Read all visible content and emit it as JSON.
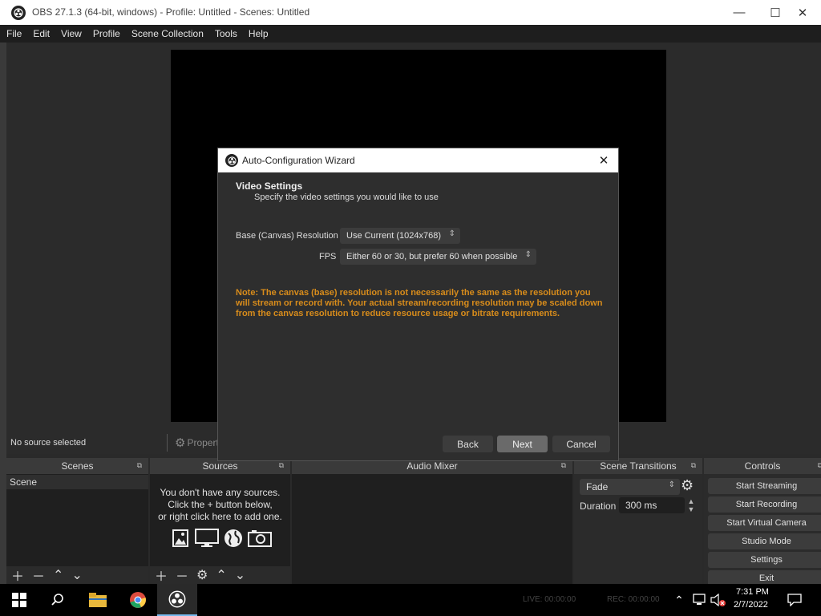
{
  "window": {
    "title": "OBS 27.1.3 (64-bit, windows) - Profile: Untitled - Scenes: Untitled",
    "minimize": "—",
    "maximize": "☐",
    "close": "✕"
  },
  "menu": {
    "items": [
      "File",
      "Edit",
      "View",
      "Profile",
      "Scene Collection",
      "Tools",
      "Help"
    ]
  },
  "status": {
    "no_source": "No source selected",
    "properties": "Properties"
  },
  "panels": {
    "scenes": {
      "title": "Scenes",
      "items": [
        "Scene"
      ]
    },
    "sources": {
      "title": "Sources",
      "empty_line1": "You don't have any sources.",
      "empty_line2": "Click the + button below,",
      "empty_line3": "or right click here to add one."
    },
    "audio_mixer": {
      "title": "Audio Mixer"
    },
    "scene_transitions": {
      "title": "Scene Transitions",
      "transition": "Fade",
      "duration_label": "Duration",
      "duration_value": "300 ms"
    },
    "controls": {
      "title": "Controls",
      "buttons": [
        "Start Streaming",
        "Start Recording",
        "Start Virtual Camera",
        "Studio Mode",
        "Settings",
        "Exit"
      ]
    }
  },
  "dialog": {
    "title": "Auto-Configuration Wizard",
    "heading": "Video Settings",
    "subheading": "Specify the video settings you would like to use",
    "resolution_label": "Base (Canvas) Resolution",
    "resolution_value": "Use Current (1024x768)",
    "fps_label": "FPS",
    "fps_value": "Either 60 or 30, but prefer 60 when possible",
    "note": "Note: The canvas (base) resolution is not necessarily the same as the resolution you will stream or record with. Your actual stream/recording resolution may be scaled down from the canvas resolution to reduce resource usage or bitrate requirements.",
    "back": "Back",
    "next": "Next",
    "cancel": "Cancel",
    "note_color": "#d88c1b"
  },
  "statusbar": {
    "live": "LIVE: 00:00:00",
    "rec": "REC: 00:00:00"
  },
  "taskbar": {
    "time": "7:31 PM",
    "date": "2/7/2022"
  }
}
